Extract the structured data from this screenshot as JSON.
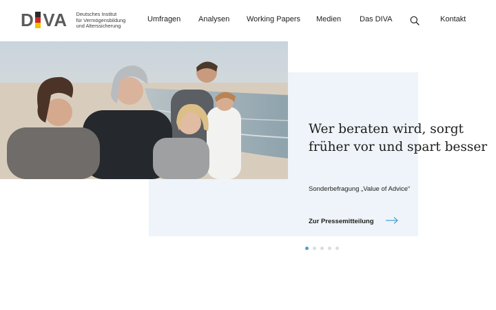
{
  "brand": {
    "logo_text_left": "D",
    "logo_text_right": "VA",
    "subtitle_line1": "Deutsches Institut",
    "subtitle_line2": "für Vermögensbildung",
    "subtitle_line3": "und Alterssicherung",
    "colors": {
      "black": "#2b2b2b",
      "red": "#d2261d",
      "gold": "#f1c300"
    }
  },
  "nav": {
    "items": [
      {
        "label": "Umfragen"
      },
      {
        "label": "Analysen"
      },
      {
        "label": "Working Papers"
      },
      {
        "label": "Medien"
      },
      {
        "label": "Das DIVA"
      }
    ],
    "search_icon": "search-icon",
    "contact_label": "Kontakt"
  },
  "hero": {
    "headline": "Wer beraten wird, sorgt früher vor und spart besser",
    "subtitle": "Sonderbefragung „Value of Advice“",
    "link_label": "Zur Pressemitteilung",
    "link_icon": "arrow-right-icon",
    "card_color": "#eef4f9",
    "accent_color": "#4a9fd8"
  },
  "carousel": {
    "slide_count": 5,
    "active_index": 1
  }
}
